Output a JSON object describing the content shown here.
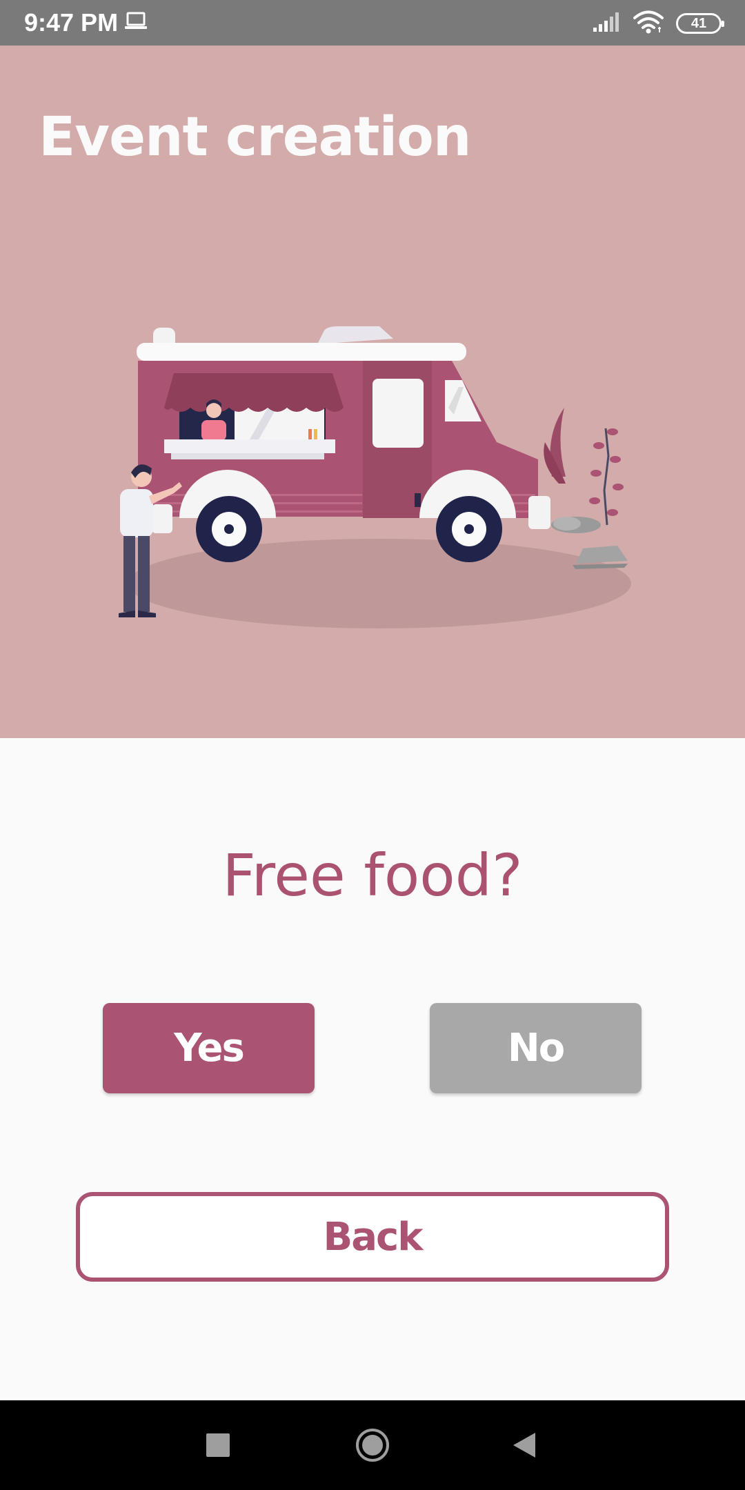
{
  "status_bar": {
    "time": "9:47 PM",
    "battery": "41",
    "icons": [
      "laptop-icon",
      "signal-icon",
      "wifi-icon",
      "battery-icon"
    ]
  },
  "header": {
    "title": "Event creation",
    "illustration": "food-truck-illustration"
  },
  "main": {
    "question": "Free food?",
    "yes_label": "Yes",
    "no_label": "No",
    "back_label": "Back"
  },
  "nav_bar": {
    "icons": [
      "recents-icon",
      "home-icon",
      "back-icon"
    ]
  },
  "colors": {
    "status_bar": "#7a7a7a",
    "hero_background": "#d3abaa",
    "accent": "#ab5372",
    "disabled": "#a8a8a8",
    "background": "#fafafa"
  }
}
